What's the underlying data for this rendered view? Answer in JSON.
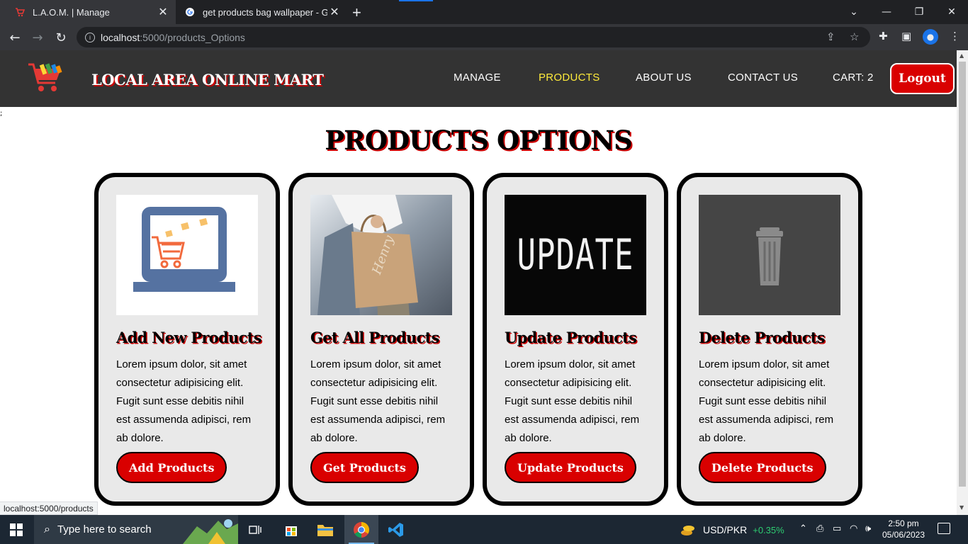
{
  "browser": {
    "tabs": [
      {
        "title": "L.A.O.M. | Manage",
        "active": true
      },
      {
        "title": "get products bag wallpaper - Go",
        "active": false
      }
    ],
    "new_tab_label": "+",
    "url_host": "localhost",
    "url_path": ":5000/products_Options",
    "status_url": "localhost:5000/products"
  },
  "site": {
    "brand": "LOCAL AREA ONLINE MART",
    "nav": {
      "manage": "MANAGE",
      "products": "PRODUCTS",
      "about": "ABOUT US",
      "contact": "CONTACT US",
      "cart": "CART: 2"
    },
    "logout": "Logout",
    "stray_text": ";",
    "accent_color": "#d90000",
    "active_nav_color": "#ffeb3b"
  },
  "page": {
    "title": "PRODUCTS OPTIONS",
    "cards": [
      {
        "title": "Add New Products",
        "text": "Lorem ipsum dolor, sit amet consectetur adipisicing elit. Fugit sunt esse debitis nihil est assumenda adipisci, rem ab dolore.",
        "button": "Add Products",
        "image_icon": "laptop-cart-illustration"
      },
      {
        "title": "Get All Products",
        "text": "Lorem ipsum dolor, sit amet consectetur adipisicing elit. Fugit sunt esse debitis nihil est assumenda adipisci, rem ab dolore.",
        "button": "Get Products",
        "image_icon": "shopping-bag-photo",
        "bag_text": "Henry"
      },
      {
        "title": "Update Products",
        "text": "Lorem ipsum dolor, sit amet consectetur adipisicing elit. Fugit sunt esse debitis nihil est assumenda adipisci, rem ab dolore.",
        "button": "Update Products",
        "image_icon": "update-chalkboard",
        "image_text": "UPDATE"
      },
      {
        "title": "Delete Products",
        "text": "Lorem ipsum dolor, sit amet consectetur adipisicing elit. Fugit sunt esse debitis nihil est assumenda adipisci, rem ab dolore.",
        "button": "Delete Products",
        "image_icon": "trash-can-icon"
      }
    ]
  },
  "taskbar": {
    "search_placeholder": "Type here to search",
    "ticker_label": "USD/PKR",
    "ticker_change": "+0.35%",
    "time": "2:50 pm",
    "date": "05/06/2023"
  }
}
